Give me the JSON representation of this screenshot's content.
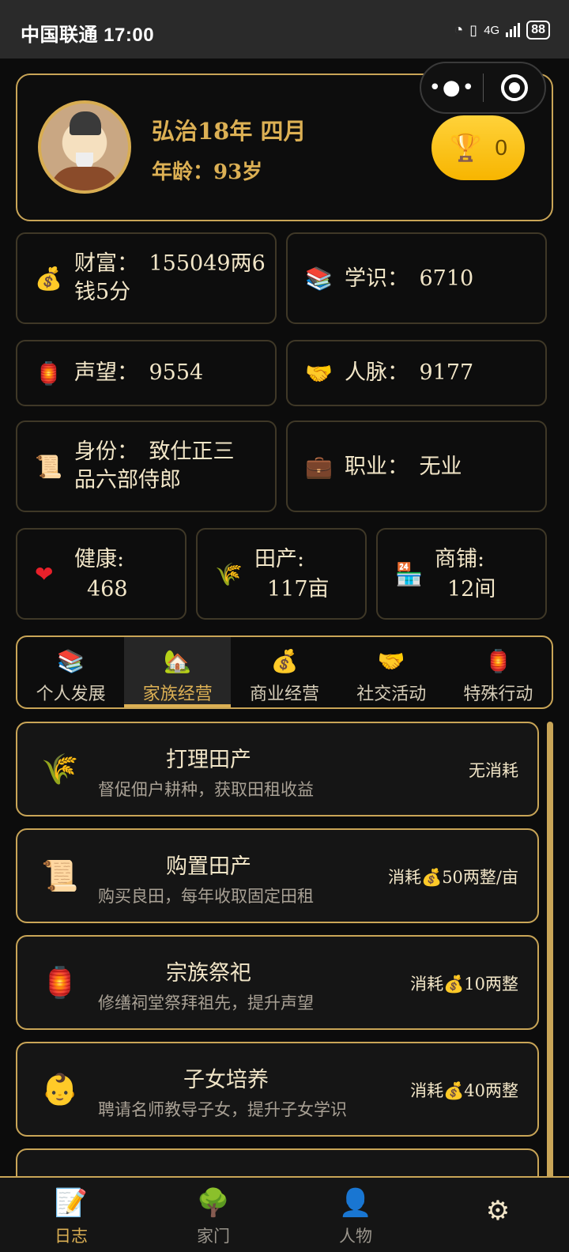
{
  "status_bar": {
    "carrier_time": "中国联通 17:00",
    "network": "4G",
    "battery": "88"
  },
  "profile": {
    "date": "弘治18年 四月",
    "age": "年龄：93岁",
    "trophy_count": "0"
  },
  "stats": {
    "wealth": "财富：　155049两6钱5分",
    "knowledge": "学识：　6710",
    "reputation": "声望：　9554",
    "connections": "人脉：　9177",
    "identity": "身份：　致仕正三品六部侍郎",
    "career": "职业：　无业",
    "health_label": "健康:",
    "health_value": "468",
    "farmland_label": "田产:",
    "farmland_value": "117亩",
    "shops_label": "商铺:",
    "shops_value": "12间"
  },
  "tabs": [
    {
      "label": "个人发展",
      "icon": "books-icon"
    },
    {
      "label": "家族经营",
      "icon": "house-icon"
    },
    {
      "label": "商业经营",
      "icon": "money-bag-icon"
    },
    {
      "label": "社交活动",
      "icon": "handshake-icon"
    },
    {
      "label": "特殊行动",
      "icon": "lantern-icon"
    }
  ],
  "active_tab": "家族经营",
  "actions": [
    {
      "title": "打理田产",
      "desc": "督促佃户耕种，获取田租收益",
      "cost": "无消耗",
      "icon": "rice-icon"
    },
    {
      "title": "购置田产",
      "desc": "购买良田，每年收取固定田租",
      "cost": "消耗💰50两整/亩",
      "icon": "scroll-icon"
    },
    {
      "title": "宗族祭祀",
      "desc": "修缮祠堂祭拜祖先，提升声望",
      "cost": "消耗💰10两整",
      "icon": "lantern-icon"
    },
    {
      "title": "子女培养",
      "desc": "聘请名师教导子女，提升子女学识",
      "cost": "消耗💰40两整",
      "icon": "baby-icon"
    }
  ],
  "bottom_nav": [
    {
      "label": "日志",
      "icon": "memo-icon"
    },
    {
      "label": "家门",
      "icon": "tree-icon"
    },
    {
      "label": "人物",
      "icon": "person-icon"
    },
    {
      "label": "",
      "icon": "gear-icon"
    }
  ],
  "colors": {
    "gold": "#dcb054",
    "border": "#c9a557",
    "background": "#0c0c0c",
    "trophy": "#ffd23a"
  }
}
